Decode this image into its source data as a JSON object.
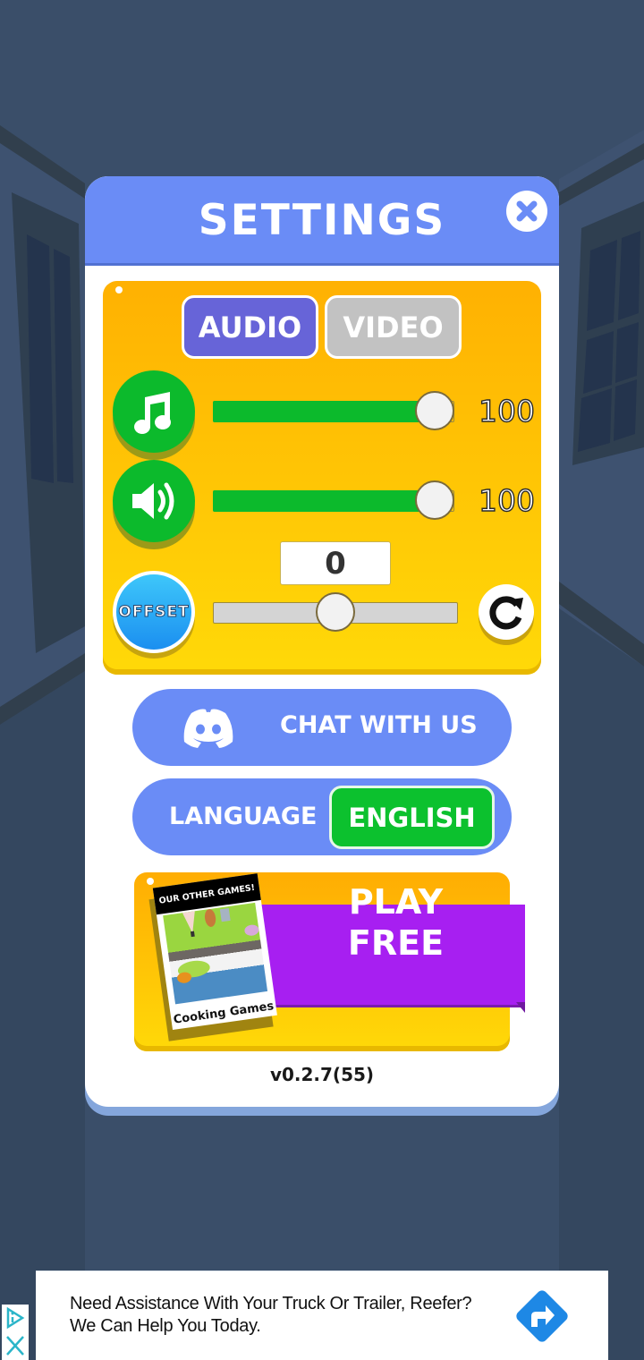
{
  "dialog": {
    "title": "SETTINGS",
    "close_icon": "close-x-icon"
  },
  "audio_panel": {
    "tabs": [
      {
        "label": "AUDIO",
        "active": true
      },
      {
        "label": "VIDEO",
        "active": false
      }
    ],
    "music": {
      "icon": "music-note-icon",
      "value": 100,
      "value_label": "100",
      "max": 100
    },
    "volume": {
      "icon": "speaker-icon",
      "value": 100,
      "value_label": "100",
      "max": 100
    },
    "offset": {
      "button_label": "OFFSET",
      "value": 0,
      "value_label": "0",
      "min": -100,
      "max": 100,
      "reset_icon": "reset-arrow-icon"
    }
  },
  "chat": {
    "label": "CHAT WITH US",
    "icon": "discord-icon"
  },
  "language": {
    "label": "LANGUAGE",
    "selected": "ENGLISH"
  },
  "promo": {
    "card_header": "OUR OTHER GAMES!",
    "card_caption": "Cooking Games",
    "ribbon_line1": "PLAY",
    "ribbon_line2": "FREE"
  },
  "version": "v0.2.7(55)",
  "ad": {
    "line1": "Need Assistance With Your Truck Or Trailer, Reefer?",
    "line2": "We Can Help You Today.",
    "cta_icon": "directions-arrow-icon",
    "adchoices_icon": "adchoices-icon",
    "close_icon": "ad-close-icon"
  },
  "colors": {
    "header_blue": "#6a8cf6",
    "panel_orange": "#ffb102",
    "panel_yellow": "#ffd908",
    "green": "#0cba2c",
    "tab_active": "#6764d8",
    "tab_inactive": "#c2c2c2",
    "ribbon_purple": "#a71ff1",
    "background": "#3a4e69"
  }
}
